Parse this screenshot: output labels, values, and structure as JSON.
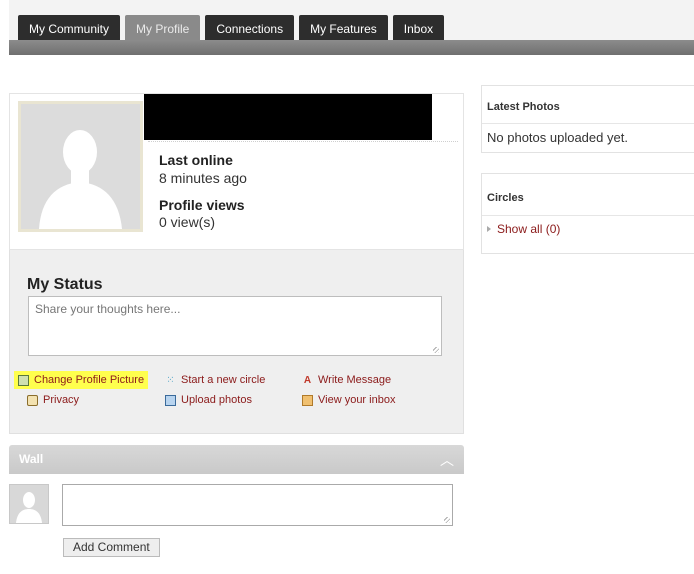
{
  "nav": {
    "tabs": [
      {
        "label": "My Community"
      },
      {
        "label": "My Profile",
        "active": true
      },
      {
        "label": "Connections"
      },
      {
        "label": "My Features"
      },
      {
        "label": "Inbox"
      }
    ]
  },
  "profile": {
    "last_online_label": "Last online",
    "last_online_value": "8 minutes ago",
    "profile_views_label": "Profile views",
    "profile_views_value": "0 view(s)"
  },
  "status": {
    "title": "My Status",
    "placeholder": "Share your thoughts here..."
  },
  "actions": {
    "change_picture": "Change Profile Picture",
    "new_circle": "Start a new circle",
    "write_message": "Write Message",
    "privacy": "Privacy",
    "upload_photos": "Upload photos",
    "view_inbox": "View your inbox"
  },
  "wall": {
    "title": "Wall",
    "add_comment_label": "Add Comment"
  },
  "sidebar": {
    "latest_photos_title": "Latest Photos",
    "latest_photos_empty": "No photos uploaded yet.",
    "circles_title": "Circles",
    "circles_show_all": "Show all (0)"
  },
  "colors": {
    "link": "#8b1a1a",
    "highlight": "#ffff4d",
    "tab_bg": "#2d2d2d",
    "tab_active_bg": "#8a8a8a"
  }
}
